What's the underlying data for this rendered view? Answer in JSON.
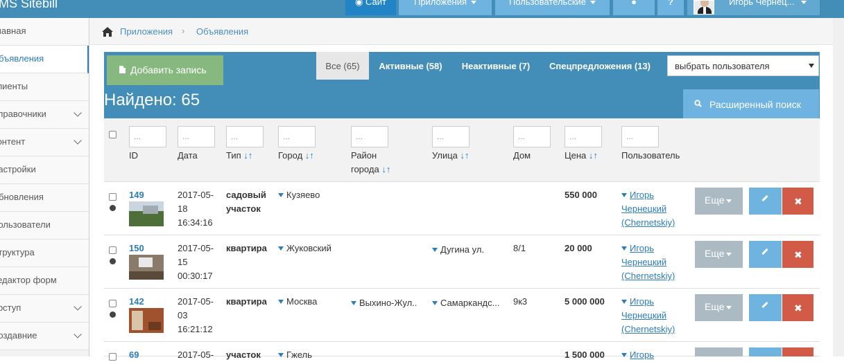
{
  "topbar": {
    "brand": "LMS Sitebill",
    "site": "Сайт",
    "apps": "Приложения",
    "user_menu": "Пользовательские",
    "user_name": "Игорь Чернец..."
  },
  "sidebar": {
    "items": [
      {
        "label": "Главная"
      },
      {
        "label": "Объявления"
      },
      {
        "label": "Клиенты"
      },
      {
        "label": "Справочники"
      },
      {
        "label": "Контент"
      },
      {
        "label": "Настройки"
      },
      {
        "label": "Обновления"
      },
      {
        "label": "Пользователи"
      },
      {
        "label": "Структура"
      },
      {
        "label": "Редактор форм"
      },
      {
        "label": "Доступ"
      },
      {
        "label": "Создавние"
      }
    ]
  },
  "breadcrumb": {
    "items": [
      "Приложения",
      "Объявления"
    ],
    "sep": "›"
  },
  "panel": {
    "add_label": "Добавить запись",
    "tabs": [
      "Все (65)",
      "Активные (58)",
      "Неактивные (7)",
      "Спецпредложения (13)"
    ],
    "user_select": "выбрать пользователя",
    "found": "Найдено: 65",
    "advanced": "Расширенный поиск"
  },
  "columns": {
    "id": "ID",
    "date": "Дата",
    "type": "Тип",
    "city": "Город",
    "district_1": "Район",
    "district_2": "города",
    "street": "Улица",
    "house": "Дом",
    "price": "Цена",
    "user": "Пользователь",
    "arrows": "↓↑",
    "placeholder": "..."
  },
  "rows": [
    {
      "id": "149",
      "date1": "2017-05-",
      "date2": "18",
      "date3": "16:34:16",
      "type1": "садовый",
      "type2": "участок",
      "city": "Кузяево",
      "district": "",
      "street": "",
      "house": "",
      "price": "550 000",
      "user1": "Игорь",
      "user2": "Чернецкий",
      "user3": "(Chernetskiy)"
    },
    {
      "id": "150",
      "date1": "2017-05-",
      "date2": "15",
      "date3": "00:30:17",
      "type1": "квартира",
      "type2": "",
      "city": "Жуковский",
      "district": "",
      "street": "Дугина ул.",
      "house": "8/1",
      "price": "20 000",
      "user1": "Игорь",
      "user2": "Чернецкий",
      "user3": "(Chernetskiy)"
    },
    {
      "id": "142",
      "date1": "2017-05-",
      "date2": "03",
      "date3": "16:21:12",
      "type1": "квартира",
      "type2": "",
      "city": "Москва",
      "district": "Выхино-Жул..",
      "street": "Самаркандс...",
      "house": "9к3",
      "price": "5 000 000",
      "user1": "Игорь",
      "user2": "Чернецкий",
      "user3": "(Chernetskiy)"
    },
    {
      "id": "69",
      "date1": "2017-05-",
      "date2": "",
      "date3": "",
      "type1": "участок",
      "type2": "",
      "city": "Гжель",
      "district": "",
      "street": "",
      "house": "",
      "price": "1 500 000",
      "user1": "Игорь",
      "user2": "",
      "user3": ""
    }
  ],
  "actions": {
    "more": "Еще"
  }
}
